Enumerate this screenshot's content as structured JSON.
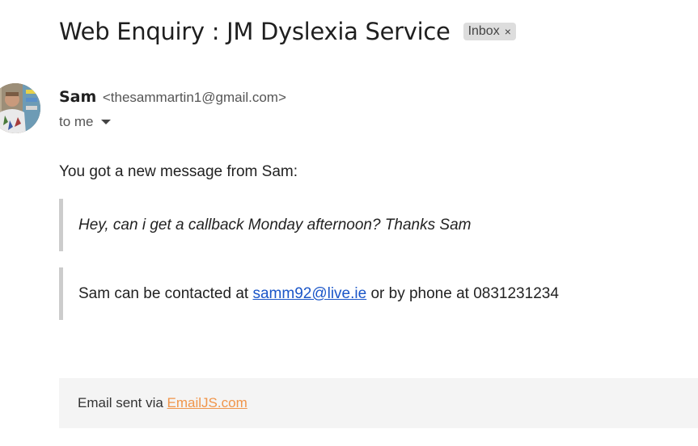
{
  "email": {
    "subject": "Web Enquiry : JM Dyslexia Service",
    "label": {
      "text": "Inbox",
      "close_glyph": "×"
    },
    "sender": {
      "name": "Sam",
      "email": "<thesammartin1@gmail.com>"
    },
    "recipient_text": "to me",
    "body": {
      "intro": "You got a new message from Sam:",
      "message": "Hey, can i get a callback Monday afternoon? Thanks Sam",
      "contact_prefix": "Sam can be contacted at ",
      "contact_email": "samm92@live.ie",
      "contact_suffix": " or by phone at 0831231234"
    },
    "footer": {
      "prefix": "Email sent via ",
      "link_text": "EmailJS.com"
    }
  },
  "colors": {
    "link_blue": "#1a55c8",
    "footer_link_orange": "#f0954a",
    "chip_background": "#dddddd",
    "quote_border": "#cccccc",
    "footer_background": "#f4f4f4"
  },
  "icons": {
    "chip_close": "close-icon",
    "recipient_dropdown": "caret-down-icon"
  }
}
